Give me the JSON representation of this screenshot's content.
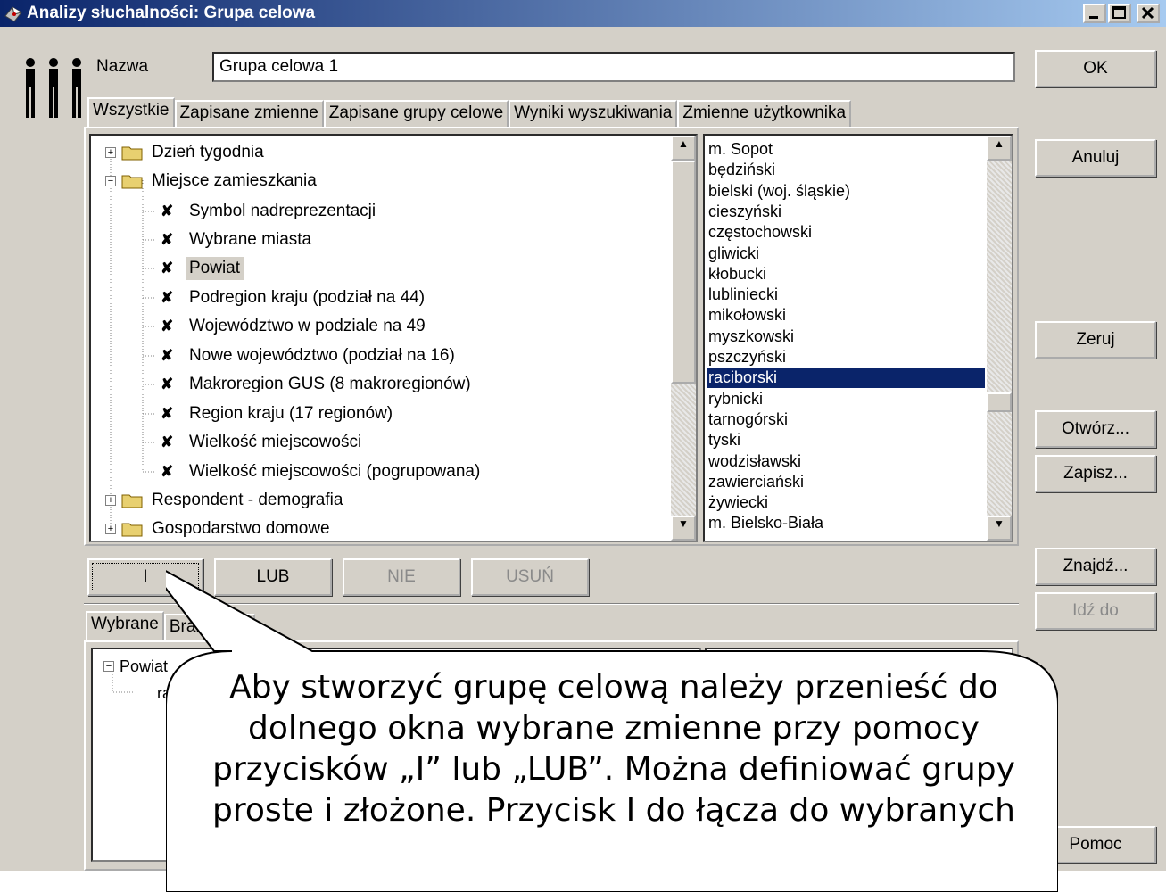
{
  "window": {
    "title": "Analizy słuchalności: Grupa celowa",
    "app_icon": "chart-app-icon"
  },
  "name_field": {
    "label": "Nazwa",
    "value": "Grupa celowa 1"
  },
  "tabs": [
    {
      "label": "Wszystkie",
      "active": true
    },
    {
      "label": "Zapisane zmienne",
      "active": false
    },
    {
      "label": "Zapisane grupy celowe",
      "active": false
    },
    {
      "label": "Wyniki wyszukiwania",
      "active": false
    },
    {
      "label": "Zmienne użytkownika",
      "active": false
    }
  ],
  "tree": {
    "folders": [
      {
        "label": "Dzień tygodnia",
        "expanded": false
      },
      {
        "label": "Miejsce zamieszkania",
        "expanded": true
      },
      {
        "label": "Respondent - demografia",
        "expanded": false
      },
      {
        "label": "Gospodarstwo domowe",
        "expanded": false
      }
    ],
    "children": [
      "Symbol nadreprezentacji",
      "Wybrane miasta",
      "Powiat",
      "Podregion kraju (podział na 44)",
      "Województwo w podziale na 49",
      "Nowe województwo (podział na 16)",
      "Makroregion GUS (8 makroregionów)",
      "Region kraju (17 regionów)",
      "Wielkość miejscowości",
      "Wielkość miejscowości (pogrupowana)"
    ],
    "selected_child": "Powiat"
  },
  "values_list": {
    "items": [
      "m. Sopot",
      "będziński",
      "bielski (woj. śląskie)",
      "cieszyński",
      "częstochowski",
      "gliwicki",
      "kłobucki",
      "lubliniecki",
      "mikołowski",
      "myszkowski",
      "pszczyński",
      "raciborski",
      "rybnicki",
      "tarnogórski",
      "tyski",
      "wodzisławski",
      "zawierciański",
      "żywiecki",
      "m. Bielsko-Biała"
    ],
    "selected": "raciborski"
  },
  "operators": {
    "and": "I",
    "or": "LUB",
    "not": "NIE",
    "delete": "USUŃ"
  },
  "bottom_tabs": [
    {
      "label": "Wybrane",
      "active": true
    },
    {
      "label": "Braki dany",
      "active": false
    }
  ],
  "selected_tree": {
    "root": "Powiat",
    "child": "ra"
  },
  "side_buttons": {
    "ok": "OK",
    "cancel": "Anuluj",
    "reset": "Zeruj",
    "open": "Otwórz...",
    "save": "Zapisz...",
    "find": "Znajdź...",
    "goto": "Idź do",
    "help": "Pomoc"
  },
  "callout": {
    "text": "Aby stworzyć grupę celową należy przenieść do dolnego okna wybrane zmienne przy pomocy przycisków „I” lub „LUB”. Można definiować grupy proste i złożone. Przycisk I do łącza do wybranych"
  }
}
